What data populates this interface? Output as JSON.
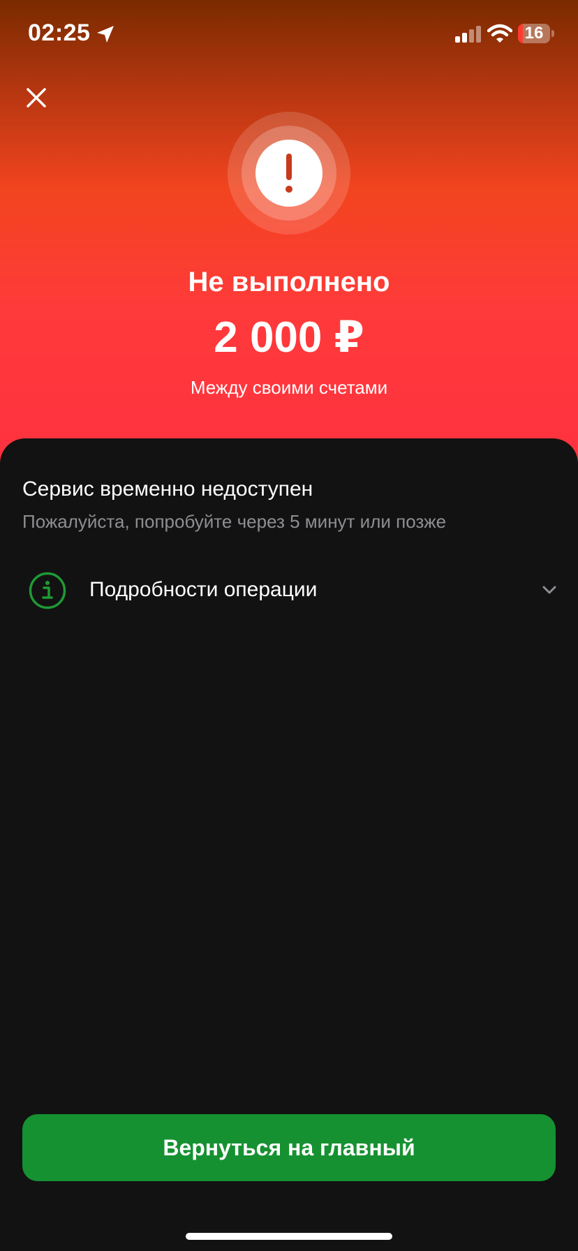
{
  "status_bar": {
    "time": "02:25",
    "battery_level": "16",
    "battery_fraction": 0.16,
    "battery_color": "#ff3b30",
    "icons": [
      "location-arrow-icon",
      "cellular-signal-icon",
      "wifi-icon",
      "battery-icon"
    ]
  },
  "header": {
    "close_icon": "close-icon",
    "status_icon": "exclamation-icon",
    "title": "Не выполнено",
    "amount": "2 000 ₽",
    "subtitle": "Между своими счетами"
  },
  "error": {
    "title": "Сервис временно недоступен",
    "description": "Пожалуйста, попробуйте через 5 минут или позже"
  },
  "details": {
    "icon": "info-icon",
    "label": "Подробности операции",
    "expand_icon": "chevron-down-icon"
  },
  "actions": {
    "home_button_label": "Вернуться на главный"
  },
  "colors": {
    "gradient_top": "#7a2a00",
    "gradient_mid": "#f2441f",
    "gradient_bottom": "#ff3140",
    "sheet_background": "#121212",
    "accent_green": "#169131",
    "info_icon_green": "#1f9a35",
    "alert_red": "#c83a1c",
    "secondary_text": "#8e8e93"
  }
}
